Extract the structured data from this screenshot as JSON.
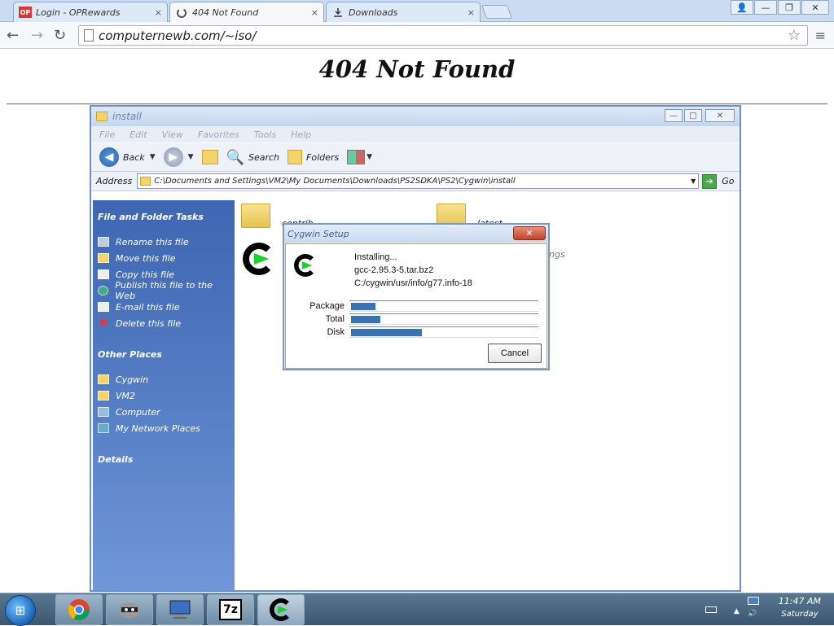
{
  "browser": {
    "tabs": [
      {
        "label": "Login - OPRewards",
        "icon": "op-rewards-icon",
        "favicon_text": "OP",
        "close": "×"
      },
      {
        "label": "404 Not Found",
        "icon": "page-loading-icon",
        "close": "×"
      },
      {
        "label": "Downloads",
        "icon": "download-icon",
        "close": "×"
      }
    ],
    "window_controls": {
      "user": "👤",
      "minimize": "—",
      "restore": "❐",
      "close": "✕"
    },
    "nav": {
      "back": "←",
      "forward": "→",
      "reload": "↻",
      "star": "☆",
      "menu": "≡"
    },
    "url": "computernewb.com/~iso/"
  },
  "page": {
    "heading": "404 Not Found"
  },
  "explorer": {
    "title": "install",
    "controls": {
      "minimize": "—",
      "maximize": "□",
      "close": "✕"
    },
    "menu": [
      "File",
      "Edit",
      "View",
      "Favorites",
      "Tools",
      "Help"
    ],
    "toolbar": {
      "back": "Back",
      "search": "Search",
      "folders": "Folders"
    },
    "address_label": "Address",
    "address": "C:\\Documents and Settings\\VM2\\My Documents\\Downloads\\PS2SDKA\\PS2\\Cygwin\\install",
    "go": "Go",
    "tasks": {
      "heading": "File and Folder Tasks",
      "items": [
        "Rename this file",
        "Move this file",
        "Copy this file",
        "Publish this file to the Web",
        "E-mail this file",
        "Delete this file"
      ]
    },
    "other_places": {
      "heading": "Other Places",
      "items": [
        "Cygwin",
        "VM2",
        "Computer",
        "My Network Places"
      ]
    },
    "details_heading": "Details",
    "files": [
      {
        "name": "contrib",
        "type": "folder"
      },
      {
        "name": "latest",
        "type": "folder"
      }
    ],
    "partial_file_text": "ngs"
  },
  "dialog": {
    "title": "Cygwin Setup",
    "close": "✕",
    "status": "Installing...",
    "package_name": "gcc-2.95.3-5.tar.bz2",
    "file_path": "C:/cygwin/usr/info/g77.info-18",
    "progress": [
      {
        "label": "Package",
        "percent": 13
      },
      {
        "label": "Total",
        "percent": 16
      },
      {
        "label": "Disk",
        "percent": 38
      }
    ],
    "cancel": "Cancel"
  },
  "taskbar": {
    "start_icon": "windows-start-icon",
    "apps": [
      "chrome-icon",
      "raccoon-icon",
      "remote-desktop-icon",
      "7zip-icon",
      "cygwin-icon"
    ],
    "sevenzip_text": "7z",
    "time": "11:47 AM",
    "day": "Saturday"
  }
}
